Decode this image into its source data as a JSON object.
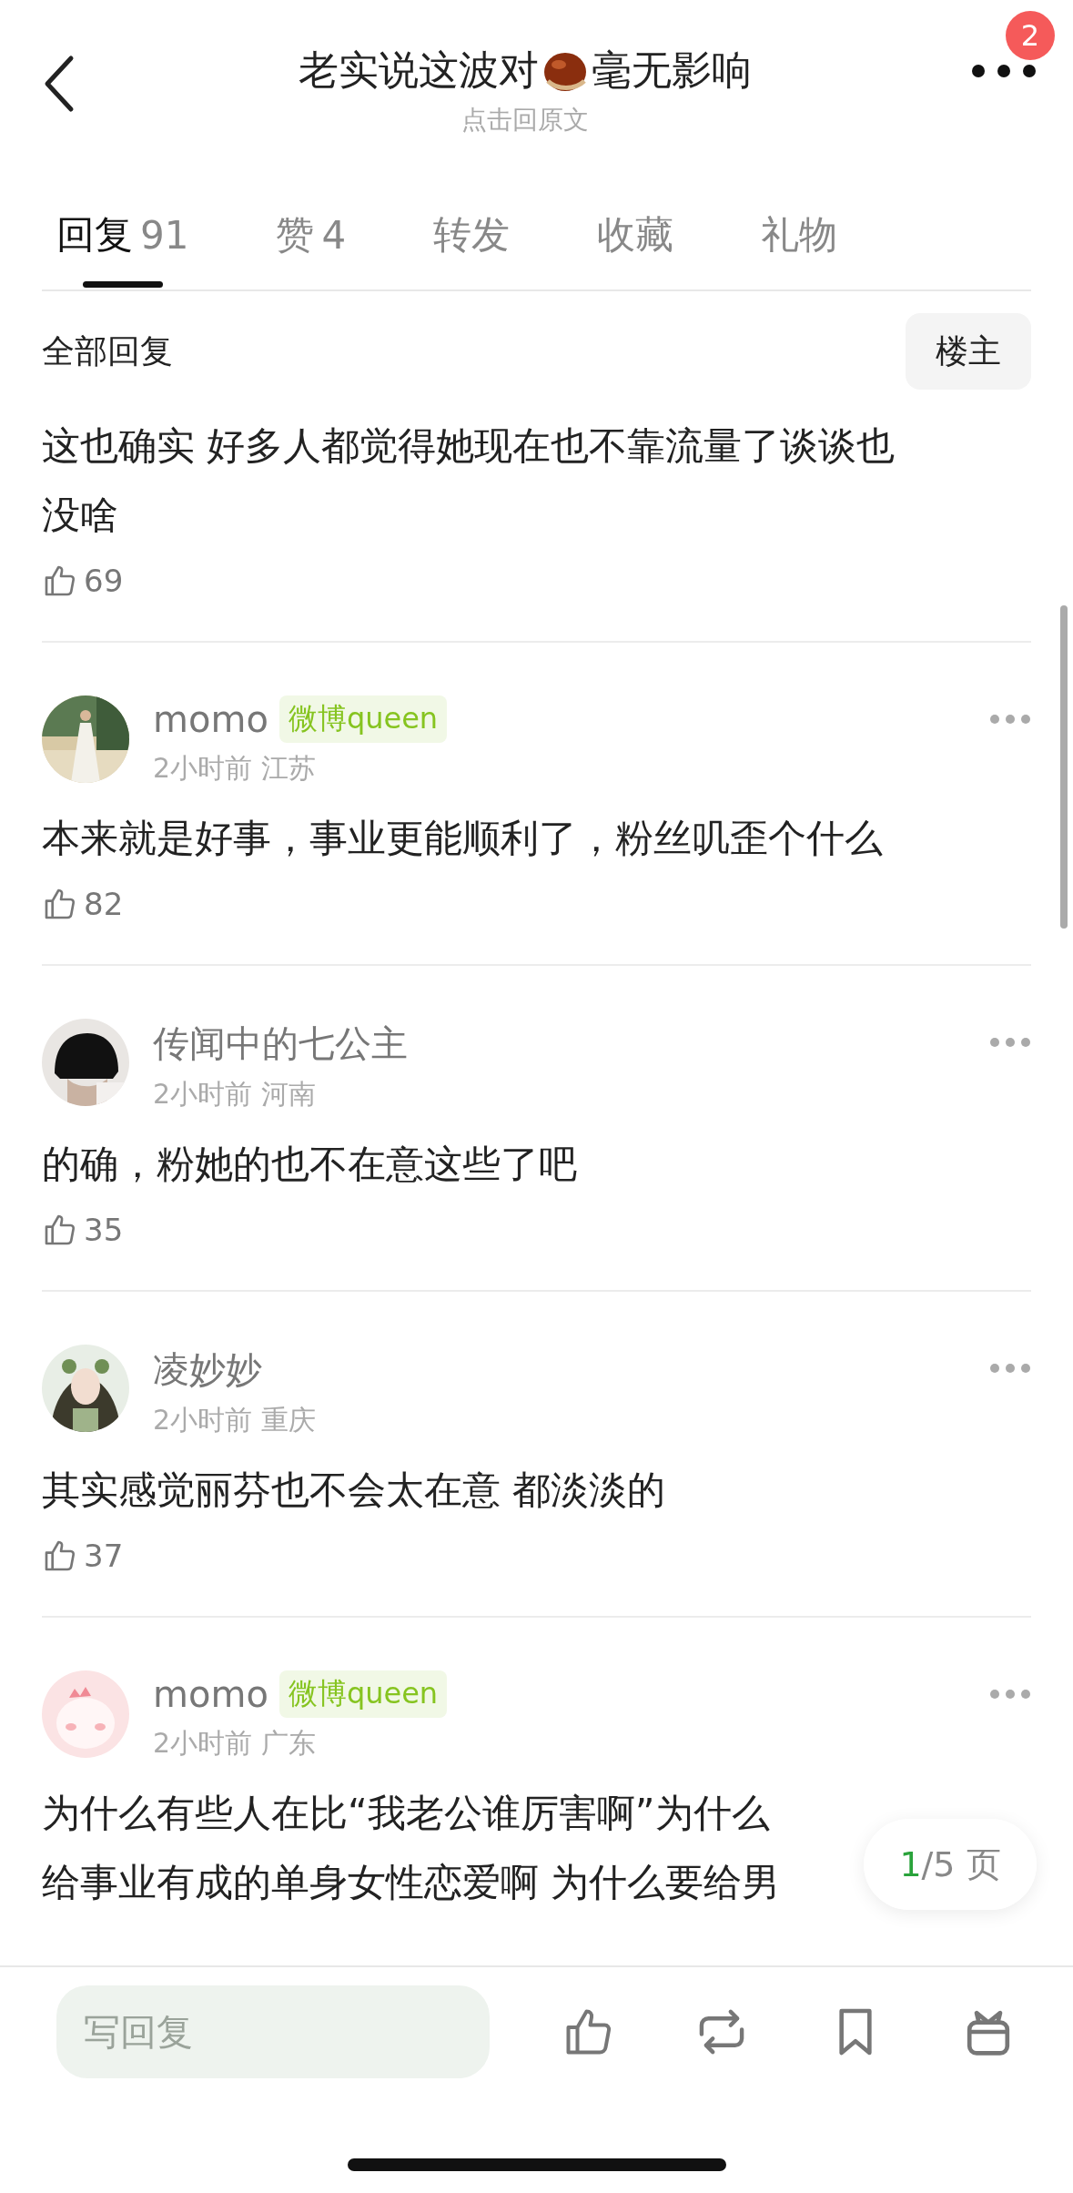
{
  "header": {
    "title_parts": [
      {
        "kind": "text",
        "text": "老实说这波对"
      },
      {
        "kind": "chestnut"
      },
      {
        "kind": "text",
        "text": "毫无影响"
      }
    ],
    "subtitle": "点击回原文",
    "badge": "2"
  },
  "tabs": [
    {
      "label": "回复",
      "count": "91",
      "selected": true
    },
    {
      "label": "赞",
      "count": "4",
      "selected": false
    },
    {
      "label": "转发",
      "selected": false
    },
    {
      "label": "收藏",
      "selected": false
    },
    {
      "label": "礼物",
      "selected": false
    }
  ],
  "filter": {
    "label": "全部回复",
    "button": "楼主"
  },
  "comments": [
    {
      "kind": "continuation",
      "lines": [
        "这也确实 好多人都觉得她现在也不靠流量了谈谈也",
        "没啥"
      ],
      "likes": "69"
    },
    {
      "kind": "full",
      "avatar": {
        "kind": "picture"
      },
      "name": "momo",
      "tag": "微博queen",
      "time": "2小时前",
      "place": "江苏",
      "lines": [
        "本来就是好事，事业更能顺利了，粉丝叽歪个什么"
      ],
      "likes": "82"
    },
    {
      "kind": "full",
      "avatar": {
        "kind": "picture"
      },
      "name": "传闻中的七公主",
      "time": "2小时前",
      "place": "河南",
      "lines": [
        "的确，粉她的也不在意这些了吧"
      ],
      "likes": "35"
    },
    {
      "kind": "full",
      "avatar": {
        "kind": "picture"
      },
      "name": "凌妙妙",
      "time": "2小时前",
      "place": "重庆",
      "lines": [
        "其实感觉丽芬也不会太在意 都淡淡的"
      ],
      "likes": "37"
    },
    {
      "kind": "full",
      "avatar": {
        "kind": "picture"
      },
      "name": "momo",
      "tag": "微博queen",
      "time": "2小时前",
      "place": "广东",
      "lines": [
        "为什么有些人在比“我老公谁厉害啊”为什么",
        "给事业有成的单身女性恋爱啊 为什么要给男"
      ]
    }
  ],
  "pager": {
    "current": "1",
    "total": "/5 页"
  },
  "bottom_bar": {
    "placeholder": "写回复"
  }
}
